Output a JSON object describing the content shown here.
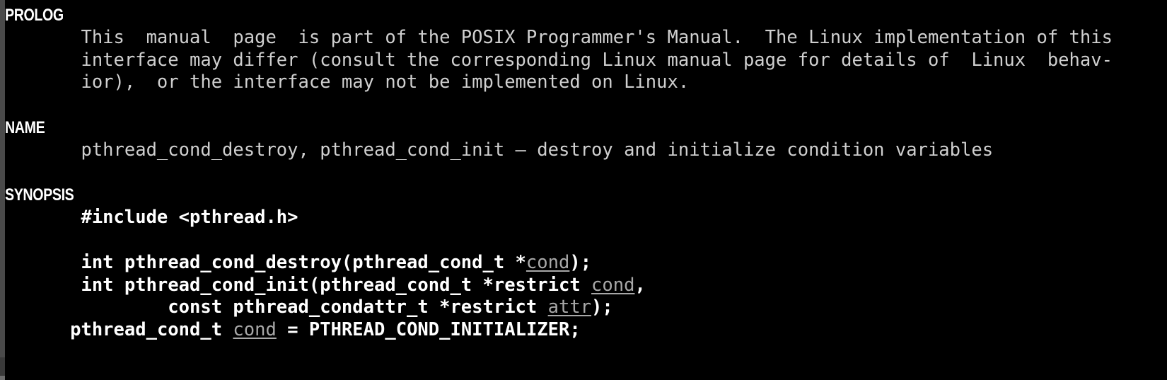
{
  "window": {
    "type": "terminal-man-page",
    "background_color": "#000000",
    "text_color": "#cfcfcf",
    "heading_color": "#ffffff",
    "param_color": "#a8a8a8",
    "frame_color": "#4a4a4a"
  },
  "manpage": {
    "sections": [
      {
        "heading": "PROLOG",
        "lines": [
          "       This  manual  page  is part of the POSIX Programmer's Manual.  The Linux implementation of this",
          "       interface may differ (consult the corresponding Linux manual page for details of  Linux  behav-",
          "       ior),  or the interface may not be implemented on Linux."
        ]
      },
      {
        "heading": "NAME",
        "lines": [
          "       pthread_cond_destroy, pthread_cond_init — destroy and initialize condition variables"
        ]
      },
      {
        "heading": "SYNOPSIS",
        "lines": []
      }
    ],
    "synopsis": {
      "include_line": "#include <pthread.h>",
      "decl1": {
        "prefix": "int pthread_cond_destroy(pthread_cond_t *",
        "param": "cond",
        "suffix": ");"
      },
      "decl2_line1": {
        "prefix": "int pthread_cond_init(pthread_cond_t *restrict ",
        "param": "cond",
        "suffix": ","
      },
      "decl2_line2": {
        "prefix": "        const pthread_condattr_t *restrict ",
        "param": "attr",
        "suffix": ");"
      },
      "decl3": {
        "prefix": "pthread_cond_t ",
        "param": "cond",
        "suffix": " = PTHREAD_COND_INITIALIZER;"
      }
    }
  }
}
